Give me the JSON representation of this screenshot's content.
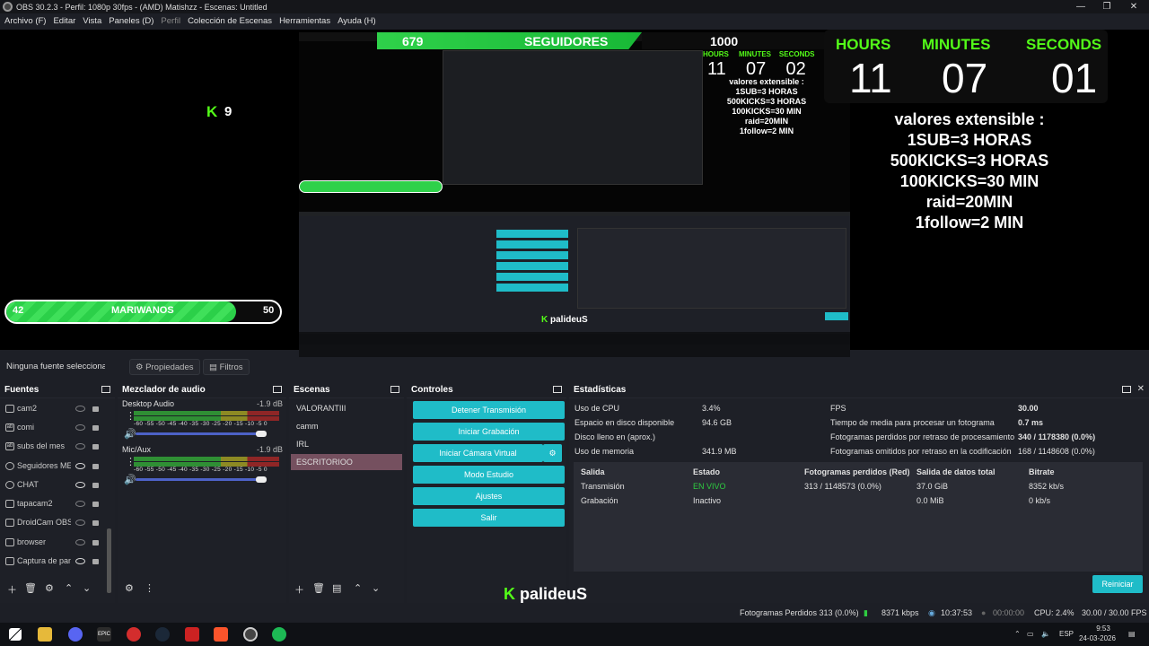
{
  "window": {
    "title": "OBS 30.2.3 - Perfil: 1080p 30fps - (AMD) Matishzz - Escenas: Untitled"
  },
  "menu": [
    "Archivo (F)",
    "Editar",
    "Vista",
    "Paneles (D)",
    "Perfil",
    "Colección de Escenas",
    "Herramientas",
    "Ayuda (H)"
  ],
  "overlay": {
    "followers_current": "679",
    "followers_label": "SEGUIDORES",
    "followers_goal": "1000",
    "kick_count": "9",
    "subs_current": "42",
    "subs_label": "MARIWANOS",
    "subs_goal": "50",
    "timer": {
      "hours_label": "HOURS",
      "minutes_label": "MINUTES",
      "seconds_label": "SECONDS",
      "hours": "11",
      "minutes": "07",
      "seconds": "01"
    },
    "extensible_lines": [
      "valores extensible :",
      "1SUB=3 HORAS",
      "500KICKS=3 HORAS",
      "100KICKS=30 MIN",
      "raid=20MIN",
      "1follow=2 MIN"
    ],
    "nested_timer": {
      "hours": "11",
      "minutes": "07",
      "seconds": "02"
    },
    "brand": "palideuS"
  },
  "source_toolbar": {
    "no_source": "Ninguna fuente seleccionada",
    "properties": "Propiedades",
    "filters": "Filtros"
  },
  "docks": {
    "sources": {
      "title": "Fuentes",
      "items": [
        {
          "label": "cam2",
          "icon": "image-icon",
          "visible": false
        },
        {
          "label": "comi",
          "icon": "text-icon",
          "visible": false
        },
        {
          "label": "subs del mes",
          "icon": "text-icon",
          "visible": false
        },
        {
          "label": "Seguidores ME",
          "icon": "browser-icon",
          "visible": true
        },
        {
          "label": "CHAT",
          "icon": "browser-icon",
          "visible": true
        },
        {
          "label": "tapacam2",
          "icon": "image-icon",
          "visible": false
        },
        {
          "label": "DroidCam OBS",
          "icon": "camera-icon",
          "visible": false
        },
        {
          "label": "browser",
          "icon": "browser-icon",
          "visible": false
        },
        {
          "label": "Captura de pan",
          "icon": "monitor-icon",
          "visible": true
        }
      ]
    },
    "audio": {
      "title": "Mezclador de audio",
      "channels": [
        {
          "name": "Desktop Audio",
          "db": "-1.9 dB",
          "level": 0.69
        },
        {
          "name": "Mic/Aux",
          "db": "-1.9 dB",
          "level": 0
        }
      ],
      "scale": "-60 -55 -50 -45 -40 -35 -30 -25 -20 -15 -10 -5 0"
    },
    "scenes": {
      "title": "Escenas",
      "items": [
        "VALORANTIII",
        "camm",
        "IRL",
        "ESCRITORIOO"
      ],
      "selected": 3
    },
    "controls": {
      "title": "Controles",
      "buttons": [
        "Detener Transmisión",
        "Iniciar Grabación",
        "Iniciar Cámara Virtual",
        "Modo Estudio",
        "Ajustes",
        "Salir"
      ]
    },
    "stats": {
      "title": "Estadísticas",
      "left": [
        {
          "k": "Uso de CPU",
          "v": "3.4%"
        },
        {
          "k": "Espacio en disco disponible",
          "v": "94.6 GB"
        },
        {
          "k": "Disco lleno en (aprox.)",
          "v": ""
        },
        {
          "k": "Uso de memoria",
          "v": "341.9 MB"
        }
      ],
      "right": [
        {
          "k": "FPS",
          "v": "30.00"
        },
        {
          "k": "Tiempo de media para procesar un fotograma",
          "v": "0.7 ms"
        },
        {
          "k": "Fotogramas perdidos por retraso de procesamiento",
          "v": "340 / 1178380 (0.0%)"
        },
        {
          "k": "Fotogramas omitidos por retraso en la codificación",
          "v": "168 / 1148608 (0.0%)"
        }
      ],
      "table_headers": [
        "Salida",
        "Estado",
        "Fotogramas perdidos (Red)",
        "Salida de datos total",
        "Bitrate"
      ],
      "rows": [
        [
          "Transmisión",
          "EN VIVO",
          "313 / 1148573 (0.0%)",
          "37.0 GiB",
          "8352 kb/s"
        ],
        [
          "Grabación",
          "Inactivo",
          "",
          "0.0 MiB",
          "0 kb/s"
        ]
      ],
      "reset": "Reiniciar"
    }
  },
  "status": {
    "dropped": "Fotogramas Perdidos 313 (0.0%)",
    "kbps": "8371 kbps",
    "live_time": "10:37:53",
    "rec_time": "00:00:00",
    "cpu": "CPU: 2.4%",
    "fps": "30.00 / 30.00 FPS"
  },
  "taskbar": {
    "lang": "ESP",
    "time": "9:53",
    "date": "24-03-2026"
  },
  "colors": {
    "accent": "#1fbcc8",
    "kick": "#53fc18",
    "live": "#2ecc40"
  }
}
